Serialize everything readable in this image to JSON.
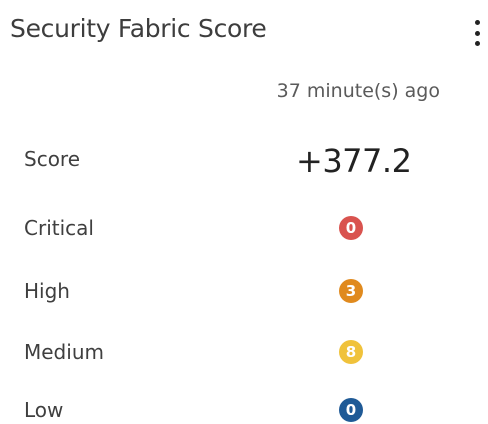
{
  "widget": {
    "title": "Security Fabric Score",
    "menu_icon": "kebab-vertical-icon",
    "timestamp": "37 minute(s) ago"
  },
  "score": {
    "label": "Score",
    "value": "+377.2"
  },
  "severities": [
    {
      "label": "Critical",
      "count": "0",
      "color": "#d9534f"
    },
    {
      "label": "High",
      "count": "3",
      "color": "#e08a1e"
    },
    {
      "label": "Medium",
      "count": "8",
      "color": "#f0c23b"
    },
    {
      "label": "Low",
      "count": "0",
      "color": "#1f5a96"
    }
  ]
}
